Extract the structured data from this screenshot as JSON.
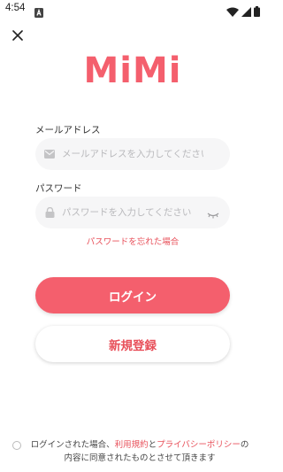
{
  "status_bar": {
    "time": "4:54",
    "app_icon": "notification-a-icon",
    "icons": [
      "wifi-icon",
      "signal-icon",
      "battery-icon"
    ]
  },
  "close": {
    "icon": "close-icon"
  },
  "logo": {
    "text": "MiMi",
    "color": "#f45f6d"
  },
  "email": {
    "label": "メールアドレス",
    "placeholder": "メールアドレスを入力してください",
    "value": "",
    "icon": "mail-icon"
  },
  "password": {
    "label": "パスワード",
    "placeholder": "パスワードを入力してください",
    "value": "",
    "icon": "lock-icon",
    "toggle_icon": "eye-closed-icon"
  },
  "forgot_password": "パスワードを忘れた場合",
  "login_button": "ログイン",
  "register_button": "新規登録",
  "terms": {
    "pre": "ログインされた場合、",
    "terms_link": "利用規約",
    "and": "と",
    "privacy_link": "プライバシーポリシー",
    "post": "の内容に同意されたものとさせて頂きます"
  },
  "colors": {
    "accent": "#f45f6d",
    "link": "#e8505a",
    "field_bg": "#f6f6f7"
  }
}
